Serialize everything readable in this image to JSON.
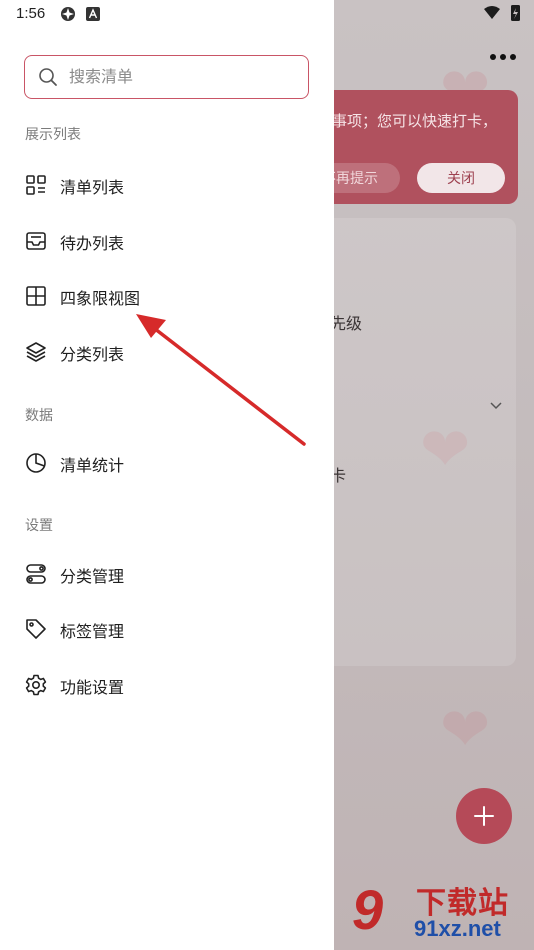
{
  "status_bar": {
    "time": "1:56"
  },
  "drawer": {
    "search": {
      "placeholder": "搜索清单",
      "value": ""
    },
    "sections": [
      {
        "title": "展示列表",
        "items": [
          {
            "label": "清单列表",
            "icon": "grid-list-icon"
          },
          {
            "label": "待办列表",
            "icon": "inbox-icon"
          },
          {
            "label": "四象限视图",
            "icon": "quadrant-icon"
          },
          {
            "label": "分类列表",
            "icon": "layers-icon"
          }
        ]
      },
      {
        "title": "数据",
        "items": [
          {
            "label": "清单统计",
            "icon": "pie-chart-icon"
          }
        ]
      },
      {
        "title": "设置",
        "items": [
          {
            "label": "分类管理",
            "icon": "category-manage-icon"
          },
          {
            "label": "标签管理",
            "icon": "tag-icon"
          },
          {
            "label": "功能设置",
            "icon": "gear-icon"
          }
        ]
      }
    ]
  },
  "background": {
    "tip_text": "事项；您可以快速打卡，",
    "dont_show_label": "不再提示",
    "close_label": "关闭",
    "priority_text": "先级",
    "checkin_text": "卡"
  },
  "watermark": {
    "top": "下载站",
    "bottom": "91xz.net",
    "mark": "9"
  },
  "colors": {
    "accent": "#c95566",
    "fab": "#b54a58",
    "arrow": "#d62a2a"
  }
}
